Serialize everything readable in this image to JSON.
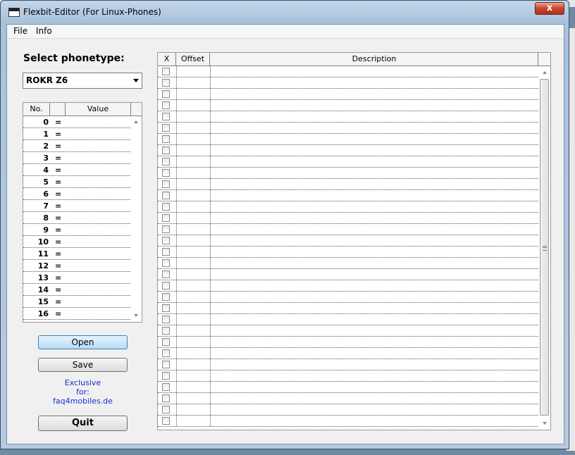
{
  "window": {
    "title": "Flexbit-Editor   (For Linux-Phones)",
    "close_glyph": "x"
  },
  "menu": {
    "file": "File",
    "info": "Info"
  },
  "phonetype": {
    "label": "Select phonetype:",
    "selected": "ROKR Z6"
  },
  "value_table": {
    "headers": {
      "no": "No.",
      "blank": "",
      "value": "Value"
    },
    "eq": "=",
    "rows": [
      "0",
      "1",
      "2",
      "3",
      "4",
      "5",
      "6",
      "7",
      "8",
      "9",
      "10",
      "11",
      "12",
      "13",
      "14",
      "15",
      "16"
    ]
  },
  "buttons": {
    "open": "Open",
    "save": "Save",
    "quit": "Quit"
  },
  "exclusive": {
    "line1": "Exclusive",
    "line2": "for:",
    "line3": "faq4mobiles.de"
  },
  "flex_table": {
    "headers": {
      "x": "X",
      "offset": "Offset",
      "description": "Description"
    },
    "row_count": 32
  },
  "colors": {
    "accent_link": "#1a2ccc",
    "close_red": "#c8432b"
  }
}
